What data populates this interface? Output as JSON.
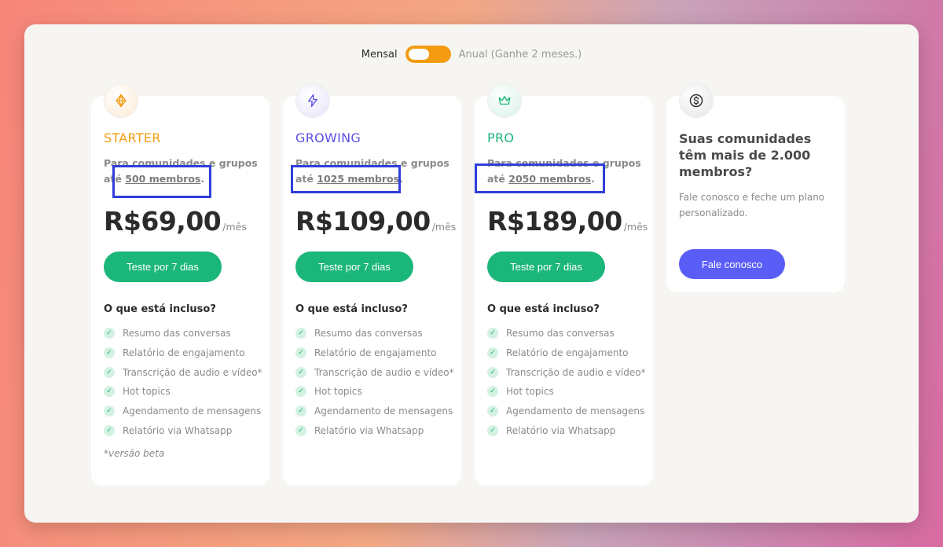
{
  "billing_toggle": {
    "monthly_label": "Mensal",
    "annual_label": "Anual (Ganhe 2 meses.)",
    "selected": "Mensal"
  },
  "plans": [
    {
      "name": "STARTER",
      "desc_prefix": "Para comunidades e grupos até ",
      "members": "500 membros",
      "desc_suffix": ".",
      "price": "R$69,00",
      "period": "/mês",
      "cta": "Teste por 7 dias",
      "included_title": "O que está incluso?",
      "features": [
        "Resumo das conversas",
        "Relatório de engajamento",
        "Transcrição de audio e vídeo*",
        "Hot topics",
        "Agendamento de mensagens",
        "Relatório via Whatsapp"
      ],
      "note": "*versão beta"
    },
    {
      "name": "GROWING",
      "desc_prefix": "Para comunidades e grupos até ",
      "members": "1025 membros",
      "desc_suffix": ".",
      "price": "R$109,00",
      "period": "/mês",
      "cta": "Teste por 7 dias",
      "included_title": "O que está incluso?",
      "features": [
        "Resumo das conversas",
        "Relatório de engajamento",
        "Transcrição de audio e vídeo*",
        "Hot topics",
        "Agendamento de mensagens",
        "Relatório via Whatsapp"
      ]
    },
    {
      "name": "PRO",
      "desc_prefix": "Para comunidades e grupos até ",
      "members": "2050 membros",
      "desc_suffix": ".",
      "price": "R$189,00",
      "period": "/mês",
      "cta": "Teste por 7 dias",
      "included_title": "O que está incluso?",
      "features": [
        "Resumo das conversas",
        "Relatório de engajamento",
        "Transcrição de audio e vídeo*",
        "Hot topics",
        "Agendamento de mensagens",
        "Relatório via Whatsapp"
      ]
    }
  ],
  "enterprise": {
    "title": "Suas comunidades têm mais de 2.000 membros?",
    "description": "Fale conosco e feche um plano personalizado.",
    "cta": "Fale conosco"
  },
  "colors": {
    "starter": "#f39c12",
    "growing": "#5b4fe0",
    "pro": "#1bb67a",
    "cta_green": "#1bb67a",
    "contact_purple": "#5b5ef6",
    "toggle_orange": "#f39c12",
    "highlight_box": "#2f3fd9"
  },
  "icons": {
    "starter": "diamond-icon",
    "growing": "lightning-icon",
    "pro": "crown-icon",
    "enterprise": "dollar-coin-icon",
    "feature": "check-icon"
  }
}
